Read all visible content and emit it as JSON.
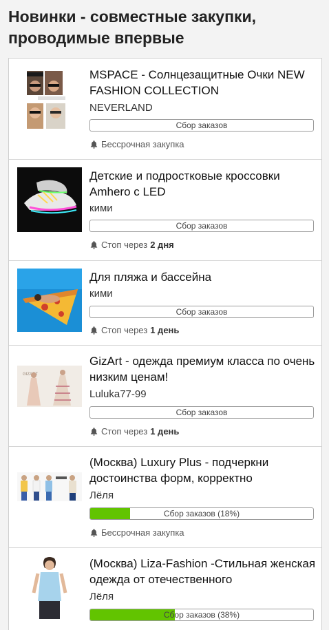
{
  "page": {
    "title": "Новинки - совместные закупки, проводимые впервые"
  },
  "items": [
    {
      "title": "MSPACE - Солнцезащитные Очки NEW FASHION COLLECTION",
      "seller": "NEVERLAND",
      "progress_label": "Сбор заказов",
      "progress_pct": 0,
      "status": "Бессрочная закупка",
      "status_bold": "",
      "image": "sunglasses-collage"
    },
    {
      "title": "Детские и подростковые кроссовки Amhero с LED",
      "seller": "кими",
      "progress_label": "Сбор заказов",
      "progress_pct": 0,
      "status": "Стоп через",
      "status_bold": "2 дня",
      "image": "led-sneakers"
    },
    {
      "title": "Для пляжа и бассейна",
      "seller": "кими",
      "progress_label": "Сбор заказов",
      "progress_pct": 0,
      "status": "Стоп через",
      "status_bold": "1 день",
      "image": "pizza-float"
    },
    {
      "title": "GizArt - одежда премиум класса по очень низким ценам!",
      "seller": "Luluka77-99",
      "progress_label": "Сбор заказов",
      "progress_pct": 0,
      "status": "Стоп через",
      "status_bold": "1 день",
      "image": "gizart-dress"
    },
    {
      "title": "(Москва) Luxury Plus - подчеркни достоинства форм, корректно",
      "seller": "Лёля",
      "progress_label": "Сбор заказов (18%)",
      "progress_pct": 18,
      "status": "Бессрочная закупка",
      "status_bold": "",
      "image": "models-lineup"
    },
    {
      "title": "(Москва) Liza-Fashion -Стильная женская одежда от отечественного",
      "seller": "Лёля",
      "progress_label": "Сбор заказов (38%)",
      "progress_pct": 38,
      "status": "",
      "status_bold": "",
      "image": "blue-blouse"
    }
  ],
  "colors": {
    "progress_fill": "#62c400",
    "background": "#f3f3f3"
  },
  "icons": {
    "status": "bell-icon"
  }
}
